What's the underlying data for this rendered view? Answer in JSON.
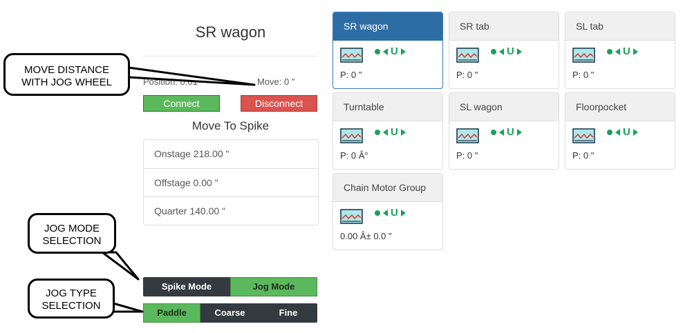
{
  "left_panel": {
    "title": "SR wagon",
    "position_text": "Position: 0.01",
    "move_text": "Move: 0 \"",
    "connect_label": "Connect",
    "disconnect_label": "Disconnect",
    "spike_heading": "Move To Spike",
    "spikes": [
      "Onstage 218.00 \"",
      "Offstage 0.00 \"",
      "Quarter 140.00 \""
    ],
    "mode_buttons": [
      {
        "label": "Spike Mode",
        "active": false
      },
      {
        "label": "Jog Mode",
        "active": true
      }
    ],
    "jog_type_buttons": [
      {
        "label": "Paddle",
        "active": true
      },
      {
        "label": "Coarse",
        "active": false
      },
      {
        "label": "Fine",
        "active": false
      }
    ]
  },
  "callouts": {
    "move_distance": {
      "line1": "MOVE DISTANCE",
      "line2": "WITH JOG WHEEL"
    },
    "jog_mode": {
      "line1": "JOG MODE",
      "line2": "SELECTION"
    },
    "jog_type": {
      "line1": "JOG TYPE",
      "line2": "SELECTION"
    }
  },
  "devices": [
    {
      "name": "SR wagon",
      "value": "P: 0 \"",
      "selected": true
    },
    {
      "name": "SR tab",
      "value": "P: 0 \"",
      "selected": false
    },
    {
      "name": "SL tab",
      "value": "P: 0 \"",
      "selected": false
    },
    {
      "name": "Turntable",
      "value": "P: 0 Â°",
      "selected": false
    },
    {
      "name": "SL wagon",
      "value": "P: 0 \"",
      "selected": false
    },
    {
      "name": "Floorpocket",
      "value": "P: 0 \"",
      "selected": false
    },
    {
      "name": "Chain Motor Group",
      "value": "0.00 Â± 0.0 \"",
      "selected": false
    }
  ],
  "icons": {
    "wave": "waveform-icon",
    "status": "status-dot-icon",
    "left": "jog-left-icon",
    "u": "u-icon",
    "right": "jog-right-icon"
  },
  "colors": {
    "accent_green": "#5cb85c",
    "accent_red": "#d9534f",
    "selected_blue": "#2e6da4",
    "status_green": "#1aa15a"
  }
}
